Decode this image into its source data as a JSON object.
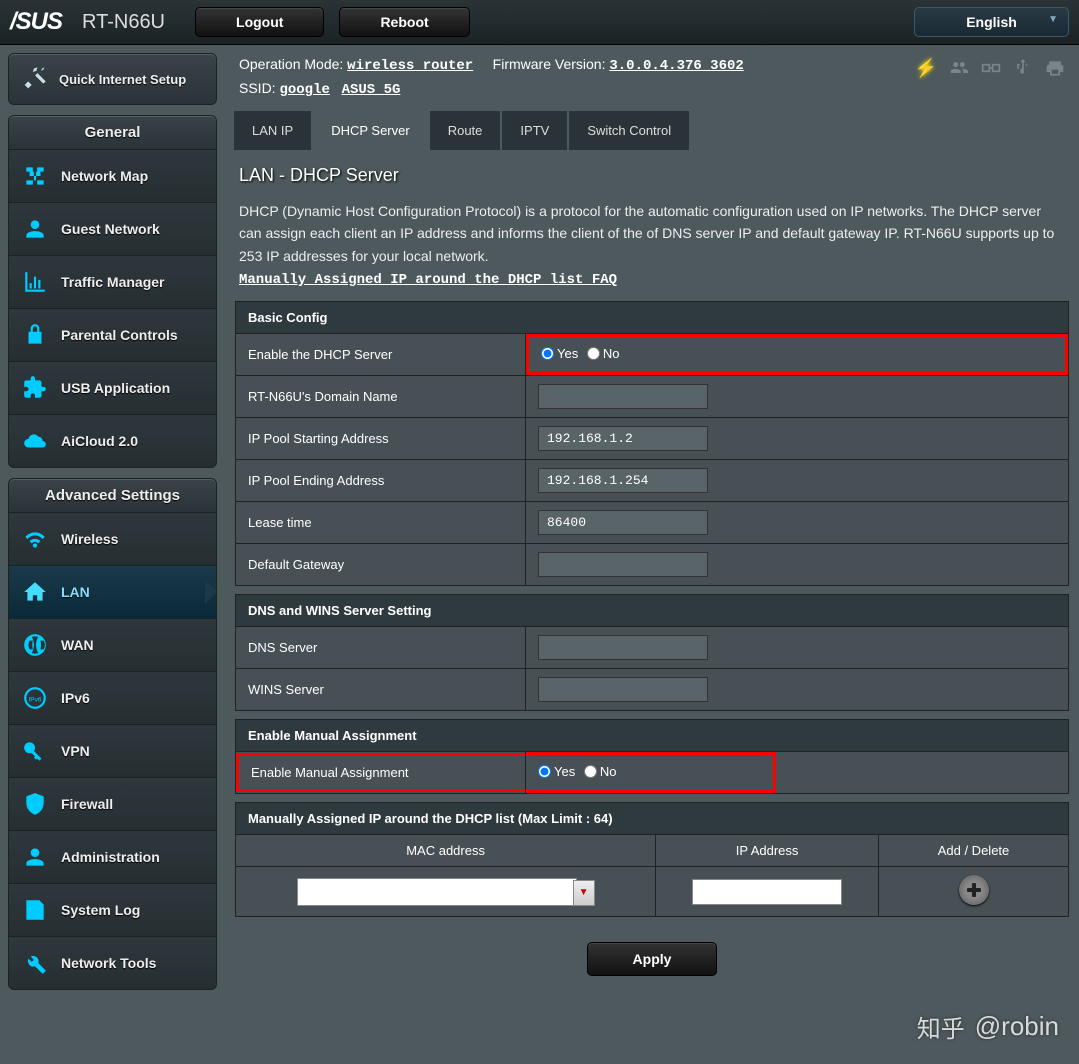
{
  "header": {
    "brand": "/SUS",
    "model": "RT-N66U",
    "logout": "Logout",
    "reboot": "Reboot",
    "language": "English"
  },
  "info": {
    "op_mode_label": "Operation Mode: ",
    "op_mode_value": "wireless router",
    "fw_label": "Firmware Version: ",
    "fw_value": "3.0.0.4.376_3602",
    "ssid_label": "SSID: ",
    "ssid_1": "google",
    "ssid_2": "ASUS_5G"
  },
  "qis": {
    "label": "Quick Internet Setup"
  },
  "sections": {
    "general": "General",
    "advanced": "Advanced Settings"
  },
  "menu_general": {
    "network_map": "Network Map",
    "guest_network": "Guest Network",
    "traffic_manager": "Traffic Manager",
    "parental_controls": "Parental Controls",
    "usb_application": "USB Application",
    "aicloud": "AiCloud 2.0"
  },
  "menu_advanced": {
    "wireless": "Wireless",
    "lan": "LAN",
    "wan": "WAN",
    "ipv6": "IPv6",
    "vpn": "VPN",
    "firewall": "Firewall",
    "administration": "Administration",
    "system_log": "System Log",
    "network_tools": "Network Tools"
  },
  "tabs": {
    "lan_ip": "LAN IP",
    "dhcp_server": "DHCP Server",
    "route": "Route",
    "iptv": "IPTV",
    "switch_control": "Switch Control"
  },
  "page": {
    "title": "LAN - DHCP Server",
    "desc": "DHCP (Dynamic Host Configuration Protocol) is a protocol for the automatic configuration used on IP networks. The DHCP server can assign each client an IP address and informs the client of the of DNS server IP and default gateway IP. RT-N66U supports up to 253 IP addresses for your local network.",
    "faq": "Manually Assigned IP around the DHCP list FAQ"
  },
  "basic": {
    "header": "Basic Config",
    "enable_dhcp": "Enable the DHCP Server",
    "yes": "Yes",
    "no": "No",
    "domain_name": "RT-N66U's Domain Name",
    "domain_name_val": "",
    "ip_start": "IP Pool Starting Address",
    "ip_start_val": "192.168.1.2",
    "ip_end": "IP Pool Ending Address",
    "ip_end_val": "192.168.1.254",
    "lease": "Lease time",
    "lease_val": "86400",
    "gateway": "Default Gateway",
    "gateway_val": ""
  },
  "dns": {
    "header": "DNS and WINS Server Setting",
    "dns_server": "DNS Server",
    "dns_val": "",
    "wins_server": "WINS Server",
    "wins_val": ""
  },
  "manual": {
    "header": "Enable Manual Assignment",
    "label": "Enable Manual Assignment",
    "yes": "Yes",
    "no": "No"
  },
  "assigned": {
    "header": "Manually Assigned IP around the DHCP list (Max Limit : 64)",
    "col_mac": "MAC address",
    "col_ip": "IP Address",
    "col_action": "Add / Delete"
  },
  "apply": "Apply",
  "watermark": {
    "z": "知乎",
    "user": "@robin"
  }
}
